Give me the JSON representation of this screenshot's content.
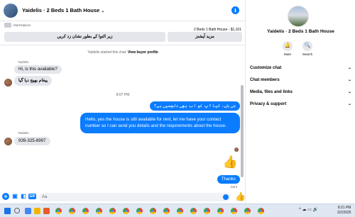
{
  "chat": {
    "title": "Yaidelis · 2 Beds 1 Bath House",
    "chevron": "⌄",
    "info_icon": "i",
    "marketplace_label": "Marketplace",
    "listing_text": "2 Beds 1 Bath House - $1,101",
    "offer_button": "زیر التوا کے بطور نشان زد کریں",
    "details_button": "مزید آپشنز",
    "system_message_prefix": "Yaidelis started this chat.",
    "system_message_link": "View buyer profile",
    "sender_name_1": "Yaidelis",
    "msg_1": "Hi, is this available?",
    "msg_2": "پیغام بھیج دیا گیا",
    "time_divider": "8:07 PM",
    "msg_3": "جی ہاں، کیا آپ کو اب بھی دلچسپی ہے؟",
    "msg_4": "Hello, yes the house is still available for rent, let me have your contact number so I can send you details and the requirements about the house.",
    "sender_name_2": "Yaidelis",
    "msg_5": "939-325-8997",
    "thumbs_icon": "👍",
    "msg_6": "Thanks",
    "sent_label": "Sent",
    "input_placeholder": "Aa",
    "plus_icon": "+",
    "gif_label": "GIF"
  },
  "panel": {
    "title": "Yaidelis · 2 Beds 1 Bath House",
    "mute_label": "Mute",
    "search_label": "Search",
    "mute_icon": "🔔",
    "search_icon": "🔍",
    "rows": [
      "Customize chat",
      "Chat members",
      "Media, files and links",
      "Privacy & support"
    ],
    "chevron": "⌄"
  },
  "taskbar": {
    "tray": "^  ☁  ▭  🔊",
    "time": "8:21 PM",
    "date": "2/2/2025"
  },
  "colors": {
    "messenger_blue": "#0a7cff",
    "incoming_bubble": "#e4e6eb",
    "taskbar": "#dfe7f2"
  }
}
